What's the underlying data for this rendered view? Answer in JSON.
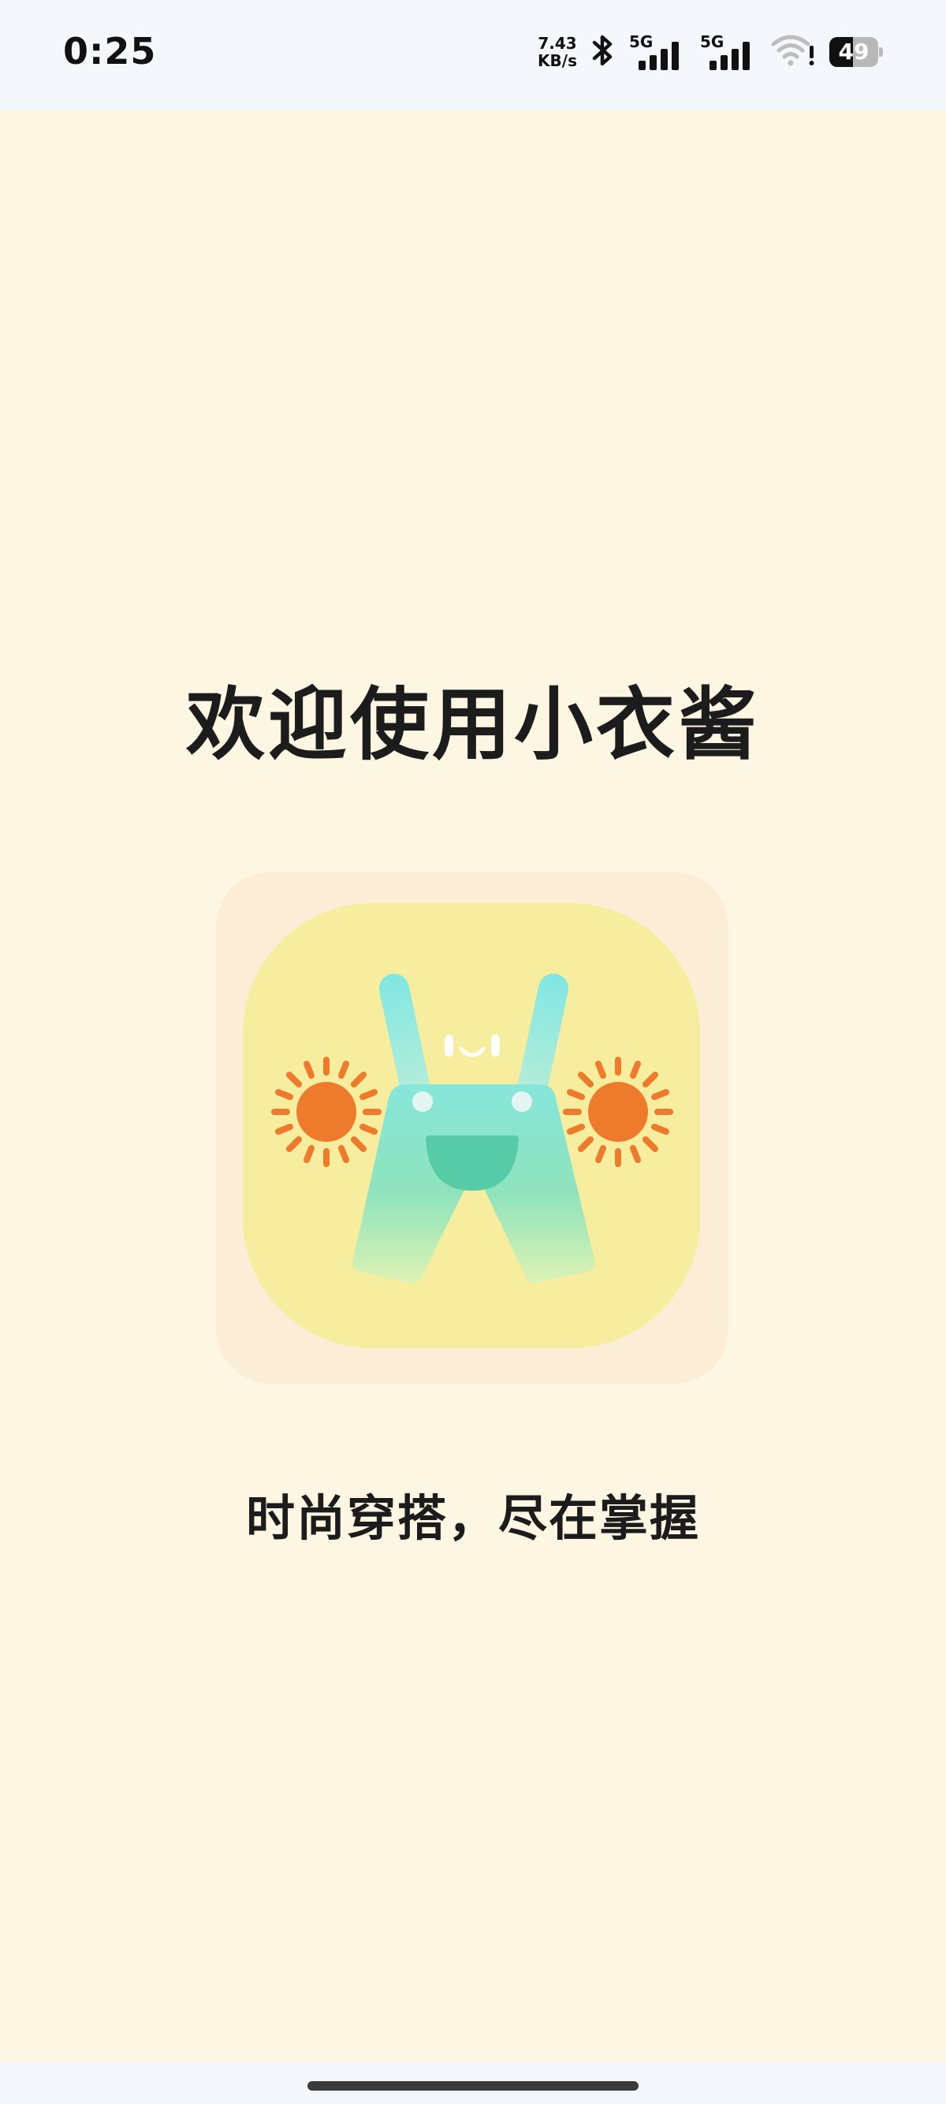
{
  "status_bar": {
    "time": "0:25",
    "net_speed_value": "7.43",
    "net_speed_unit": "KB/s",
    "sim1_label": "5G",
    "sim2_label": "5G",
    "battery_level": "49",
    "battery_fraction": 0.49,
    "icons": [
      "bluetooth-icon",
      "signal-icon",
      "signal-icon",
      "wifi-warning-icon",
      "battery-icon"
    ]
  },
  "main": {
    "title": "欢迎使用小衣酱",
    "slogan": "时尚穿搭，尽在掌握",
    "logo": "overalls-sun-logo"
  },
  "colors": {
    "background": "#FDF6E3",
    "logo_background": "#F6EE9E",
    "sun": "#EE7A2C",
    "overalls": "#7FE3C9",
    "pocket": "#57CAA6"
  }
}
